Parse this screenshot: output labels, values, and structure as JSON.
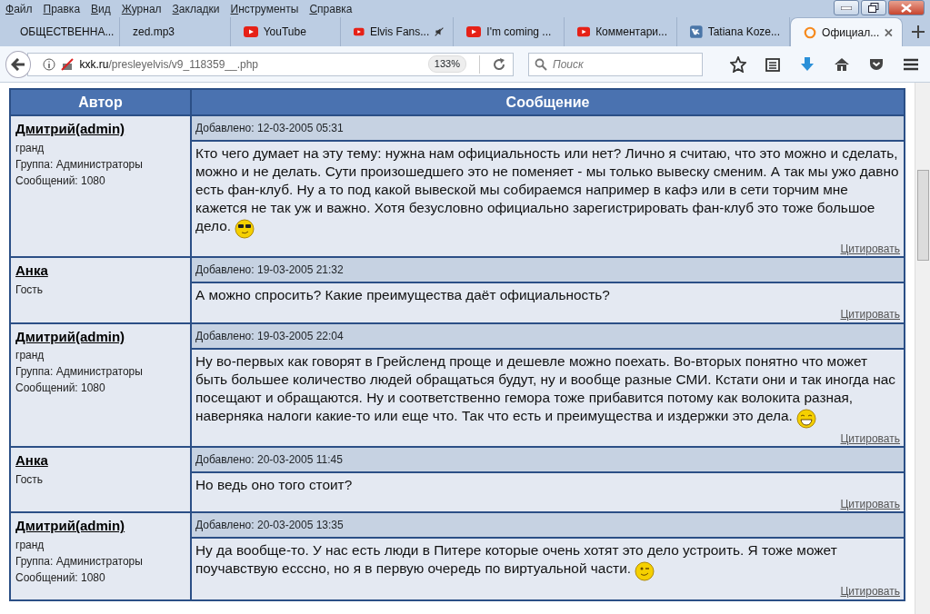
{
  "menu": [
    "Файл",
    "Правка",
    "Вид",
    "Журнал",
    "Закладки",
    "Инструменты",
    "Справка"
  ],
  "tabs": [
    {
      "label": "ОБЩЕСТВЕННА...",
      "kind": "plain",
      "selected": false
    },
    {
      "label": "zed.mp3",
      "kind": "plain",
      "selected": false
    },
    {
      "label": "YouTube",
      "kind": "video",
      "selected": false
    },
    {
      "label": "Elvis Fans...",
      "kind": "video",
      "muted": true,
      "selected": false
    },
    {
      "label": "I'm coming ...",
      "kind": "video",
      "selected": false
    },
    {
      "label": "Комментари...",
      "kind": "video",
      "selected": false
    },
    {
      "label": "Tatiana Koze...",
      "kind": "social",
      "selected": false
    },
    {
      "label": "Официал...",
      "kind": "ring",
      "selected": true
    }
  ],
  "address": {
    "domain": "kxk.ru",
    "path": "/presleyelvis/v9_118359__.php",
    "zoom": "133%"
  },
  "search": {
    "placeholder": "Поиск"
  },
  "table": {
    "columns": [
      "Автор",
      "Сообщение"
    ],
    "rows": [
      {
        "author": "Дмитрий(admin)",
        "rank": "гранд",
        "group": "Группа: Администраторы",
        "count": "Сообщений: 1080",
        "date": "Добавлено: 12-03-2005 05:31",
        "text": "Кто чего думает на эту тему: нужна нам официальность или нет? Лично я считаю, что это можно и сделать, можно и не делать. Сути произошедшего это не поменяет - мы только вывеску сменим. А так мы ужо давно есть фан-клуб. Ну а то под какой вывеской мы собираемся например в кафэ или в сети торчим мне кажется не так уж и важно. Хотя безусловно официально зарегистрировать фан-клуб это тоже большое дело.",
        "kind": "sunglasses",
        "quote": "Цитировать"
      },
      {
        "author": "Анка",
        "rank": "Гость",
        "date": "Добавлено: 19-03-2005 21:32",
        "text": "А можно спросить? Какие преимущества даёт официальность?",
        "kind": "plain",
        "quote": "Цитировать"
      },
      {
        "author": "Дмитрий(admin)",
        "rank": "гранд",
        "group": "Группа: Администраторы",
        "count": "Сообщений: 1080",
        "date": "Добавлено: 19-03-2005 22:04",
        "text": "Ну во-первых как говорят в Грейсленд проще и дешевле можно поехать. Во-вторых понятно что может быть большее количество людей обращаться будут, ну и вообще разные СМИ. Кстати они и так иногда нас посещают и обращаются. Ну и соответственно гемора тоже прибавится потому как волокита разная, наверняка налоги какие-то или еще что. Так что есть и преимущества и издержки это дела.",
        "kind": "grin",
        "quote": "Цитировать"
      },
      {
        "author": "Анка",
        "rank": "Гость",
        "date": "Добавлено: 20-03-2005 11:45",
        "text": "Но ведь оно того стоит?",
        "kind": "plain",
        "quote": "Цитировать"
      },
      {
        "author": "Дмитрий(admin)",
        "rank": "гранд",
        "group": "Группа: Администраторы",
        "count": "Сообщений: 1080",
        "date": "Добавлено: 20-03-2005 13:35",
        "text": "Ну да вообще-то. У нас есть люди в Питере которые очень хотят это дело устроить. Я тоже может поучавствую есссно, но я в первую очередь по виртуальной части.",
        "kind": "wink",
        "quote": "Цитировать"
      }
    ]
  }
}
